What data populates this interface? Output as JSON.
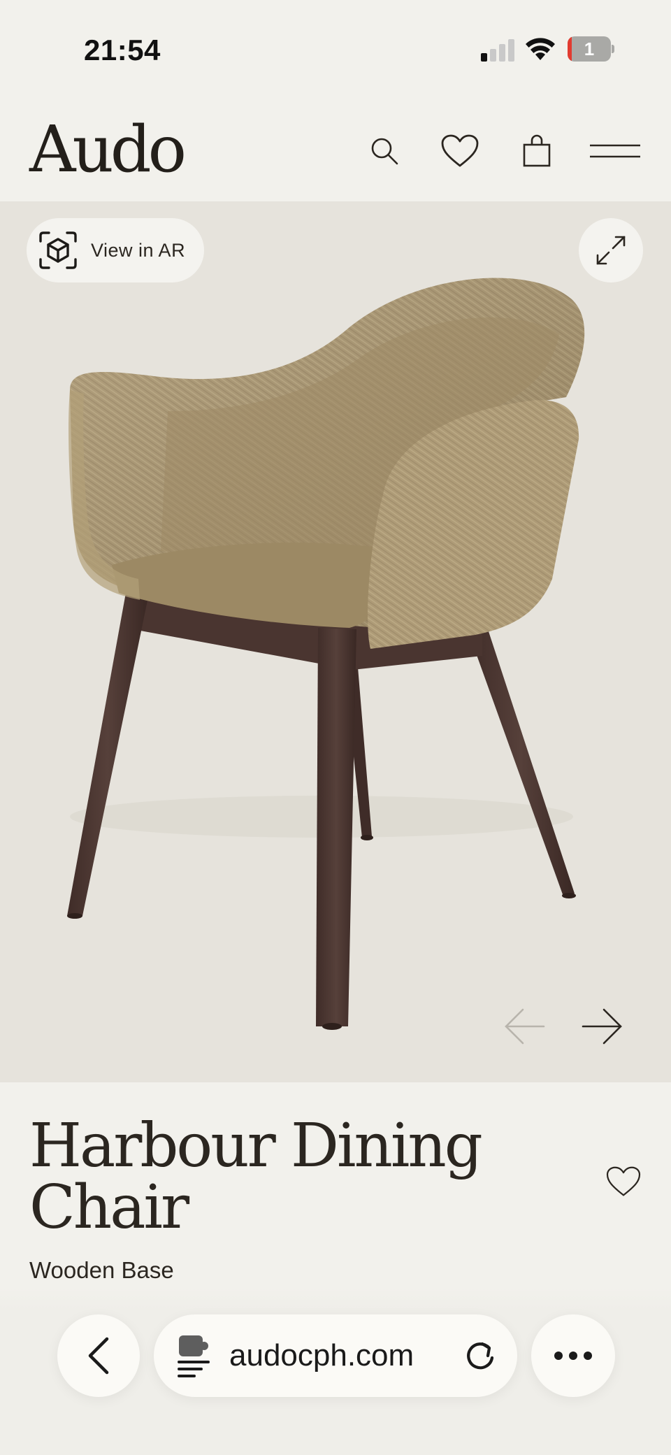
{
  "status_bar": {
    "time": "21:54",
    "battery_level": "1",
    "battery_fraction": 0.05,
    "signal_bars_active": 1
  },
  "header": {
    "logo": "Audo",
    "icons": [
      "search-icon",
      "heart-icon",
      "bag-icon",
      "menu-icon"
    ]
  },
  "hero": {
    "ar_button_label": "View in AR",
    "ar_icon": "ar-cube-icon",
    "expand_icon": "expand-icon",
    "prev_arrow": "arrow-left-icon",
    "next_arrow": "arrow-right-icon",
    "prev_disabled": true
  },
  "product": {
    "title": "Harbour Dining Chair",
    "subtitle": "Wooden Base"
  },
  "browser": {
    "url": "audocph.com",
    "back_icon": "chevron-left-icon",
    "site_icon": "site-settings-icon",
    "reload_icon": "reload-icon",
    "more_icon": "more-icon"
  },
  "colors": {
    "background": "#f2f1ec",
    "hero_bg": "#e6e3dc",
    "text": "#2b2620",
    "fabric": "#a9956f",
    "wood": "#4a3530"
  }
}
